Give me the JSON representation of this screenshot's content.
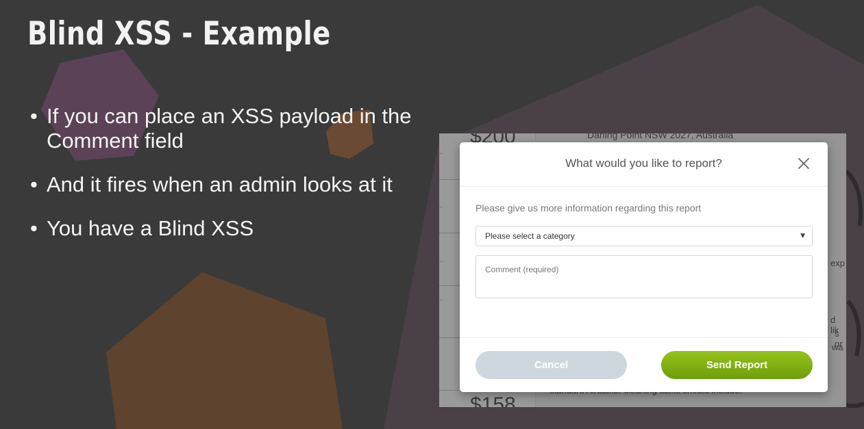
{
  "slide": {
    "title": "Blind XSS - Example",
    "bullets": [
      "If you can place an XSS payload in the Comment field",
      "And it fires when an admin looks at it",
      "You have a Blind XSS"
    ]
  },
  "background_page": {
    "address": "Darling Point NSW 2027, Australia",
    "prices": [
      "$200",
      "$158"
    ],
    "right_fragments": [
      "exp",
      "d lik",
      "s or",
      "wa"
    ],
    "bottom_text": "standard Airtasker cleaning tasks should include:"
  },
  "modal": {
    "title": "What would you like to report?",
    "close_icon": "close-icon",
    "info_text": "Please give us more information regarding this report",
    "category_select": {
      "selected": "Please select a category"
    },
    "comment_field": {
      "placeholder": "Comment (required)",
      "value": ""
    },
    "cancel_label": "Cancel",
    "send_label": "Send Report",
    "colors": {
      "send_button": "#7fae12",
      "cancel_button": "#cdd8de"
    }
  }
}
